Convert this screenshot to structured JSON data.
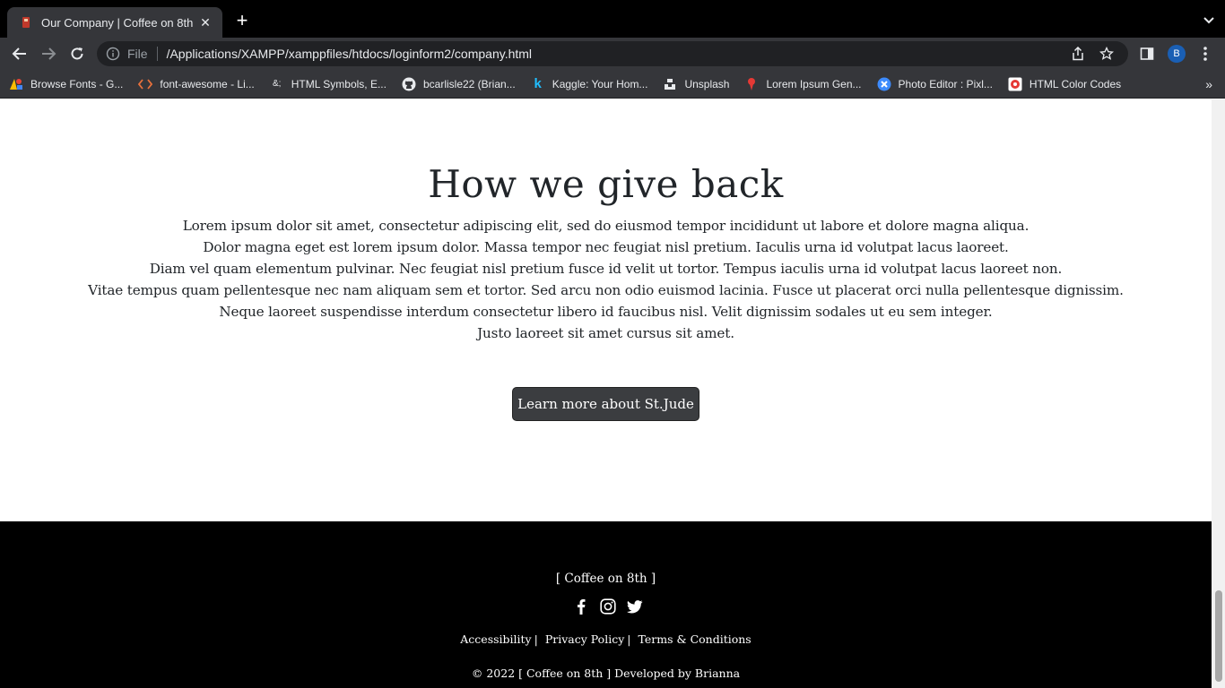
{
  "browser": {
    "tab": {
      "title": "Our Company | Coffee on 8th",
      "favicon": "coffee-favicon-icon"
    },
    "address": {
      "scheme_label": "File",
      "url": "/Applications/XAMPP/xamppfiles/htdocs/loginform2/company.html"
    },
    "profile_initial": "B",
    "bookmarks": [
      {
        "label": "Browse Fonts - G...",
        "icon": "google-fonts-icon"
      },
      {
        "label": "font-awesome - Li...",
        "icon": "code-brackets-icon"
      },
      {
        "label": "HTML Symbols, E...",
        "icon": "ampersand-icon",
        "icon_text": "&;"
      },
      {
        "label": "bcarlisle22 (Brian...",
        "icon": "github-icon"
      },
      {
        "label": "Kaggle: Your Hom...",
        "icon": "kaggle-icon",
        "icon_text": "k"
      },
      {
        "label": "Unsplash",
        "icon": "unsplash-icon"
      },
      {
        "label": "Lorem Ipsum Gen...",
        "icon": "lorem-ipsum-icon"
      },
      {
        "label": "Photo Editor : Pixl...",
        "icon": "pixlr-icon"
      },
      {
        "label": "HTML Color Codes",
        "icon": "color-codes-icon"
      }
    ],
    "bookmarks_more": "»"
  },
  "giveback": {
    "title": "How we give back",
    "lines": [
      "Lorem ipsum dolor sit amet, consectetur adipiscing elit, sed do eiusmod tempor incididunt ut labore et dolore magna aliqua.",
      "Dolor magna eget est lorem ipsum dolor. Massa tempor nec feugiat nisl pretium. Iaculis urna id volutpat lacus laoreet.",
      "Diam vel quam elementum pulvinar. Nec feugiat nisl pretium fusce id velit ut tortor. Tempus iaculis urna id volutpat lacus laoreet non.",
      "Vitae tempus quam pellentesque nec nam aliquam sem et tortor. Sed arcu non odio euismod lacinia. Fusce ut placerat orci nulla pellentesque dignissim.",
      "Neque laoreet suspendisse interdum consectetur libero id faucibus nisl. Velit dignissim sodales ut eu sem integer.",
      "Justo laoreet sit amet cursus sit amet."
    ],
    "button": "Learn more about St.Jude"
  },
  "footer": {
    "brand": "[ Coffee on 8th ]",
    "social_icons": [
      "facebook-icon",
      "instagram-icon",
      "twitter-icon"
    ],
    "links": [
      "Accessibility",
      "Privacy Policy",
      "Terms & Conditions"
    ],
    "link_separator": "|",
    "copyright": "© 2022 [ Coffee on 8th ] Developed by Brianna"
  }
}
